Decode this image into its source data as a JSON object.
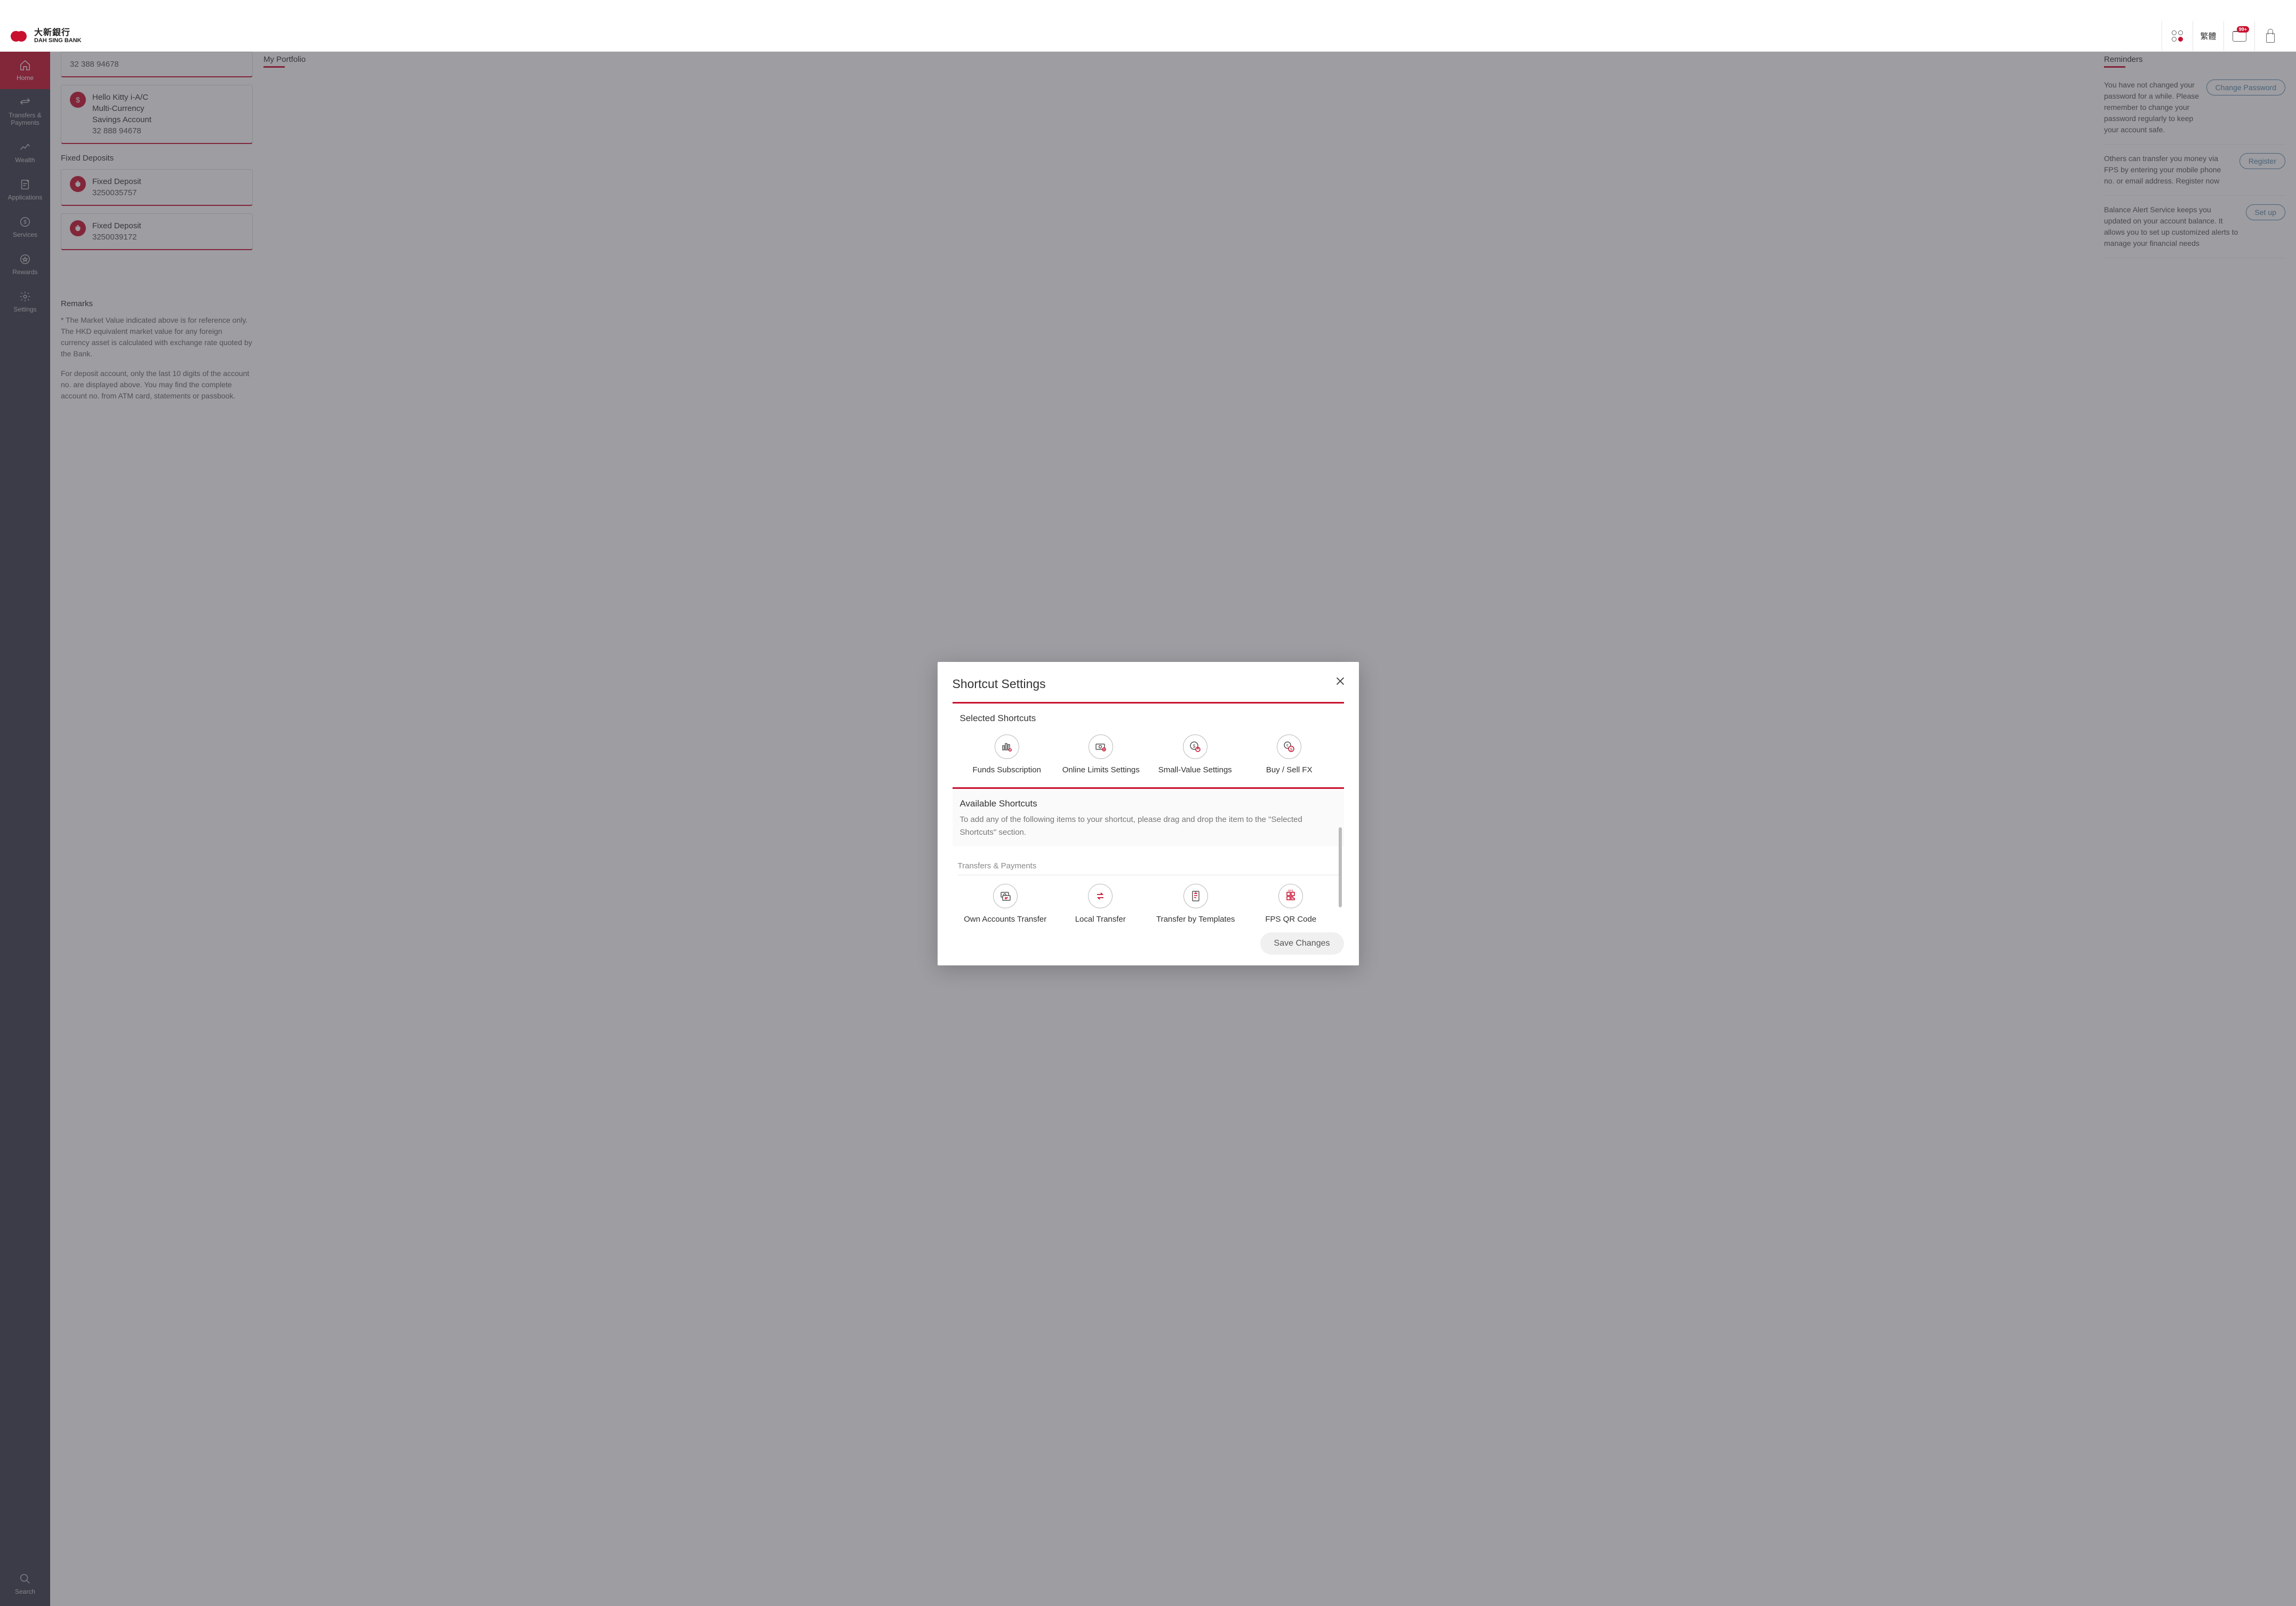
{
  "header": {
    "bank_name_cn": "大新銀行",
    "bank_name_en": "DAH SING BANK",
    "lang_label": "繁體",
    "mail_badge": "99+"
  },
  "nav": {
    "items": [
      {
        "label": "Home"
      },
      {
        "label": "Transfers & Payments"
      },
      {
        "label": "Wealth"
      },
      {
        "label": "Applications"
      },
      {
        "label": "Services"
      },
      {
        "label": "Rewards"
      },
      {
        "label": "Settings"
      }
    ],
    "search": "Search"
  },
  "accounts": {
    "a1_num": "32 388 94678",
    "a2_line1": "Hello Kitty i-A/C",
    "a2_line2": "Multi-Currency",
    "a2_line3": "Savings Account",
    "a2_num": "32 888 94678",
    "fixed_title": "Fixed Deposits",
    "fd1_name": "Fixed Deposit",
    "fd1_num": "3250035757",
    "fd2_name": "Fixed Deposit",
    "fd2_num": "3250039172"
  },
  "center": {
    "portfolio": "My Portfolio"
  },
  "remarks": {
    "title": "Remarks",
    "p1": "* The Market Value indicated above is for reference only. The HKD equivalent market value for any foreign currency asset is calculated with exchange rate quoted by the Bank.",
    "p2": "For deposit account, only the last 10 digits of the account no. are displayed above. You may find the complete account no. from ATM card, statements or passbook."
  },
  "reminders": {
    "title": "Reminders",
    "r1_text": "You have not changed your password for a while. Please remember to change your password regularly to keep your account safe.",
    "r1_btn": "Change Password",
    "r2_text": "Others can transfer you money via FPS by entering your mobile phone no. or email address. Register now",
    "r2_btn": "Register",
    "r3_text": "Balance Alert Service keeps you updated on your account balance. It allows you to set up customized alerts to manage your financial needs",
    "r3_btn": "Set up"
  },
  "modal": {
    "title": "Shortcut Settings",
    "selected_title": "Selected Shortcuts",
    "selected": [
      {
        "label": "Funds Subscription"
      },
      {
        "label": "Online Limits Settings"
      },
      {
        "label": "Small-Value Settings"
      },
      {
        "label": "Buy / Sell FX"
      }
    ],
    "available_title": "Available Shortcuts",
    "available_sub": "To add any of the following items to your shortcut, please drag and drop the item to the \"Selected Shortcuts\" section.",
    "group1": "Transfers & Payments",
    "group1_items": [
      {
        "label": "Own Accounts Transfer"
      },
      {
        "label": "Local Transfer"
      },
      {
        "label": "Transfer by Templates"
      },
      {
        "label": "FPS QR Code"
      }
    ],
    "save": "Save Changes"
  }
}
